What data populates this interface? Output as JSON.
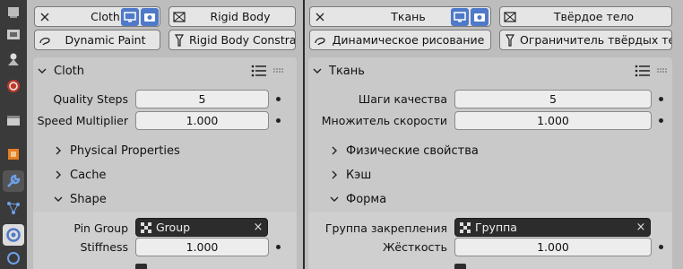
{
  "left": {
    "modifiers": {
      "cloth": "Cloth",
      "rigid_body": "Rigid Body",
      "dynamic_paint": "Dynamic Paint",
      "rigid_body_constraint": "Rigid Body Constra..."
    },
    "panel_title": "Cloth",
    "quality_steps_label": "Quality Steps",
    "quality_steps_value": "5",
    "speed_multiplier_label": "Speed Multiplier",
    "speed_multiplier_value": "1.000",
    "subpanels": {
      "physical": "Physical Properties",
      "cache": "Cache",
      "shape": "Shape"
    },
    "pin_group_label": "Pin Group",
    "pin_group_value": "Group",
    "stiffness_label": "Stiffness",
    "stiffness_value": "1.000"
  },
  "right": {
    "modifiers": {
      "cloth": "Ткань",
      "rigid_body": "Твёрдое тело",
      "dynamic_paint": "Динамическое рисование",
      "rigid_body_constraint": "Ограничитель твёрдых тел"
    },
    "panel_title": "Ткань",
    "quality_steps_label": "Шаги качества",
    "quality_steps_value": "5",
    "speed_multiplier_label": "Множитель скорости",
    "speed_multiplier_value": "1.000",
    "subpanels": {
      "physical": "Физические свойства",
      "cache": "Кэш",
      "shape": "Форма"
    },
    "pin_group_label": "Группа закрепления",
    "pin_group_value": "Группа",
    "stiffness_label": "Жёсткость",
    "stiffness_value": "1.000"
  },
  "icons": {
    "close": "×",
    "sidebar": [
      "tool-icon",
      "render-icon",
      "output-icon",
      "view-layer-icon",
      "scene-icon",
      "world-icon",
      "collection-icon",
      "object-icon",
      "modifier-icon",
      "particles-icon",
      "physics-icon",
      "constraints-icon"
    ]
  },
  "colors": {
    "accent_blue": "#4f79c9",
    "panel_bg": "#bdbdbd",
    "field_bg": "#ededed",
    "dark_field": "#2c2c2c"
  }
}
